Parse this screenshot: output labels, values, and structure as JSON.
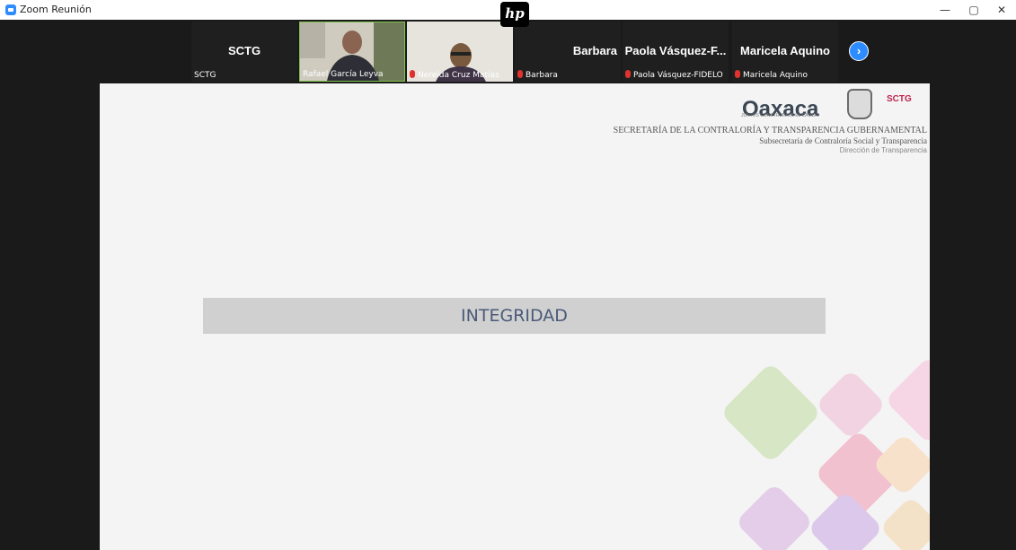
{
  "window": {
    "title": "Zoom Reunión",
    "minimize_icon": "—",
    "restore_icon": "▢",
    "close_icon": "✕"
  },
  "hp_logo": "hp",
  "participants": [
    {
      "name": "SCTG",
      "label": "SCTG",
      "muted": false,
      "video": false
    },
    {
      "name": "",
      "label": "Rafael García Leyva",
      "muted": false,
      "video": true
    },
    {
      "name": "",
      "label": "Nereida Cruz Matías",
      "muted": true,
      "video": true
    },
    {
      "name": "Barbara",
      "label": "Barbara",
      "muted": true,
      "video": false
    },
    {
      "name": "Paola Vásquez-F...",
      "label": "Paola Vásquez-FIDELO",
      "muted": true,
      "video": false
    },
    {
      "name": "Maricela Aquino",
      "label": "Maricela Aquino",
      "muted": true,
      "video": false
    }
  ],
  "next_page_icon": "›",
  "slide": {
    "logo_text": "Oaxaca",
    "logo_subtext": "JUNTOS CONSTRUIMOS EL CAMBIO",
    "sctg_logo": "SCTG",
    "header_line1": "SECRETARÍA DE LA CONTRALORÍA Y TRANSPARENCIA GUBERNAMENTAL",
    "header_line2": "Subsecretaría de Contraloría Social y Transparencia",
    "header_line3": "Dirección de Transparencia",
    "banner_text": "INTEGRIDAD"
  },
  "colors": {
    "zoom_blue": "#2D8CFF",
    "banner_text": "#4a5a78",
    "banner_bg": "#d0d0d0",
    "mute_red": "#e0332e"
  }
}
